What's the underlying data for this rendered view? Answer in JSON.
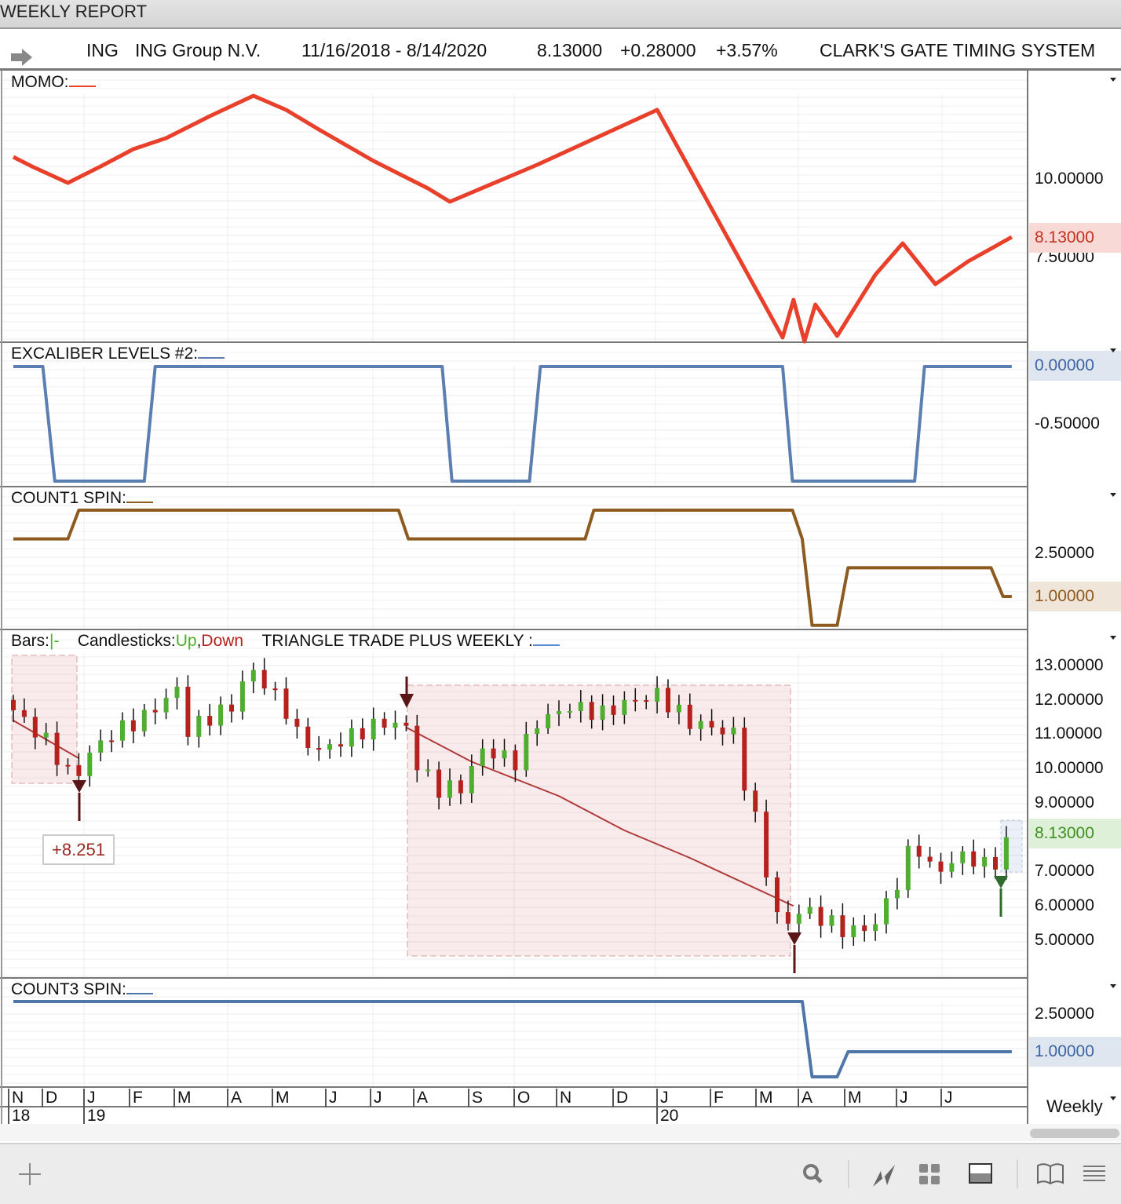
{
  "window": {
    "title": "WEEKLY REPORT"
  },
  "header": {
    "symbol": "ING",
    "company": "ING Group N.V.",
    "range": "11/16/2018 - 8/14/2020",
    "last": "8.13000",
    "change": "+0.28000",
    "pct": "+3.57%",
    "system": "CLARK'S GATE TIMING SYSTEM"
  },
  "colors": {
    "momo": "#e8402a",
    "excal": "#5b7fb0",
    "count1": "#8d5a1f",
    "count3": "#4f76a8",
    "up": "#4fae2f",
    "down": "#b5221d"
  },
  "panels": {
    "momo": {
      "label": "MOMO:",
      "ticks": [
        "10.00000",
        "7.50000"
      ],
      "current": "8.13000",
      "series": [
        [
          0,
          10.7
        ],
        [
          1.7,
          10.4
        ],
        [
          5,
          9.875
        ],
        [
          8,
          10.4
        ],
        [
          11,
          10.95
        ],
        [
          14,
          11.3
        ],
        [
          18,
          12.0
        ],
        [
          22,
          12.65
        ],
        [
          25,
          12.2
        ],
        [
          28,
          11.575
        ],
        [
          33,
          10.575
        ],
        [
          38,
          9.7
        ],
        [
          40,
          9.275
        ],
        [
          48,
          10.45
        ],
        [
          59,
          12.2
        ],
        [
          70.5,
          4.95
        ],
        [
          71.5,
          6.15
        ],
        [
          72.5,
          4.825
        ],
        [
          73.5,
          6.0
        ],
        [
          75.5,
          5.0
        ],
        [
          79,
          6.95
        ],
        [
          81.5,
          7.95
        ],
        [
          84.5,
          6.65
        ],
        [
          87.5,
          7.375
        ],
        [
          91.5,
          8.15
        ]
      ]
    },
    "excal": {
      "label": "EXCALIBER LEVELS #2:",
      "ticks": [
        "0.00000",
        "-0.50000"
      ],
      "current": "0.00000",
      "series": [
        [
          0,
          0
        ],
        [
          2.7,
          0
        ],
        [
          3.8,
          -1
        ],
        [
          12,
          -1
        ],
        [
          13,
          0
        ],
        [
          39.3,
          0
        ],
        [
          40.2,
          -1
        ],
        [
          47.3,
          -1
        ],
        [
          48.3,
          0
        ],
        [
          70.5,
          0
        ],
        [
          71.4,
          -1
        ],
        [
          82.6,
          -1
        ],
        [
          83.5,
          0
        ],
        [
          91.5,
          0
        ]
      ]
    },
    "count1": {
      "label": "COUNT1 SPIN:",
      "ticks": [
        "2.50000"
      ],
      "current": "1.00000",
      "series": [
        [
          0,
          3
        ],
        [
          5,
          3
        ],
        [
          6,
          4
        ],
        [
          35.3,
          4
        ],
        [
          36.2,
          3
        ],
        [
          52.4,
          3
        ],
        [
          53.2,
          4
        ],
        [
          71.4,
          4
        ],
        [
          72.3,
          3
        ],
        [
          73.2,
          0
        ],
        [
          75.5,
          0
        ],
        [
          76.5,
          2
        ],
        [
          89.6,
          2
        ],
        [
          90.7,
          1
        ],
        [
          91.5,
          1
        ]
      ]
    },
    "price": {
      "bars_label": "Bars:",
      "bars_glyph": "|-",
      "candles_label": "Candlesticks:",
      "up": "Up",
      "comma": ",",
      "down": "Down",
      "study": "TRIANGLE TRADE PLUS WEEKLY :",
      "ticks": [
        "13.00000",
        "12.00000",
        "11.00000",
        "10.00000",
        "9.00000",
        "7.00000",
        "6.00000",
        "5.00000"
      ],
      "current": "8.13000",
      "annotation": "+8.251",
      "closes": [
        [
          0,
          11.7
        ],
        [
          3,
          10.8
        ],
        [
          5,
          9.9
        ],
        [
          6,
          9.9
        ],
        [
          7,
          10.45
        ],
        [
          9,
          11.0
        ],
        [
          12,
          11.5
        ],
        [
          15,
          12.3
        ],
        [
          16,
          11.1
        ],
        [
          18,
          11.5
        ],
        [
          20,
          11.8
        ],
        [
          21,
          12.5
        ],
        [
          22,
          12.8
        ],
        [
          23,
          12.5
        ],
        [
          25,
          11.7
        ],
        [
          26,
          11.0
        ],
        [
          28,
          10.5
        ],
        [
          30,
          10.8
        ],
        [
          32,
          11.1
        ],
        [
          34,
          11.35
        ],
        [
          36,
          11.2
        ],
        [
          37,
          10.1
        ],
        [
          39,
          9.4
        ],
        [
          41,
          9.45
        ],
        [
          43,
          10.55
        ],
        [
          46,
          10.2
        ],
        [
          48,
          11.35
        ],
        [
          51,
          11.8
        ],
        [
          54,
          11.6
        ],
        [
          56,
          11.9
        ],
        [
          59,
          12.15
        ],
        [
          62,
          11.35
        ],
        [
          64,
          11.2
        ],
        [
          66,
          11.0
        ],
        [
          67,
          9.6
        ],
        [
          68,
          8.5
        ],
        [
          69.5,
          6.3
        ],
        [
          70.5,
          5.1
        ],
        [
          71.5,
          5.9
        ],
        [
          73.5,
          5.75
        ],
        [
          76,
          5.3
        ],
        [
          78.5,
          5.3
        ],
        [
          80.5,
          6.3
        ],
        [
          82.5,
          7.9
        ],
        [
          84.5,
          6.9
        ],
        [
          86.5,
          7.45
        ],
        [
          88.5,
          7.35
        ],
        [
          89.5,
          7.0
        ],
        [
          91.5,
          8.13
        ]
      ],
      "ma": [
        [
          [
            0,
            11.4
          ],
          [
            6,
            10.3
          ]
        ],
        [
          [
            36,
            11.2
          ],
          [
            42,
            10.2
          ],
          [
            50,
            9.2
          ],
          [
            56,
            8.2
          ],
          [
            62,
            7.4
          ],
          [
            71.5,
            6.0
          ]
        ]
      ]
    },
    "count3": {
      "label": "COUNT3 SPIN:",
      "ticks": [
        "2.50000"
      ],
      "current": "1.00000",
      "series": [
        [
          0,
          3
        ],
        [
          72.3,
          3
        ],
        [
          73.2,
          0
        ],
        [
          75.5,
          0
        ],
        [
          76.5,
          1
        ],
        [
          91.5,
          1
        ]
      ]
    }
  },
  "timeaxis": {
    "months": [
      "N",
      "D",
      "J",
      "F",
      "M",
      "A",
      "M",
      "J",
      "J",
      "A",
      "S",
      "O",
      "N",
      "D",
      "J",
      "F",
      "M",
      "A",
      "M",
      "J",
      "J"
    ],
    "years": [
      "18",
      "19",
      "20"
    ],
    "interval": "Weekly"
  },
  "toolbar": [
    "add",
    "search",
    "chart-style",
    "grid",
    "layout",
    "book",
    "menu"
  ]
}
